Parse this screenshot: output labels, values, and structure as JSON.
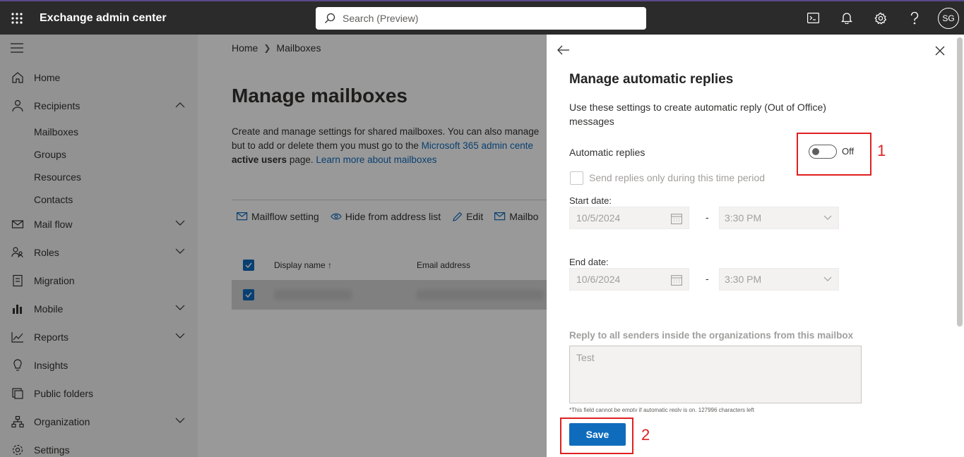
{
  "header": {
    "app_title": "Exchange admin center",
    "search_placeholder": "Search (Preview)",
    "avatar_initials": "SG"
  },
  "sidebar": {
    "items": [
      {
        "label": "Home",
        "icon": "home-icon"
      },
      {
        "label": "Recipients",
        "icon": "person-icon",
        "expanded": true
      },
      {
        "label": "Mail flow",
        "icon": "mail-icon"
      },
      {
        "label": "Roles",
        "icon": "roles-icon"
      },
      {
        "label": "Migration",
        "icon": "migration-icon"
      },
      {
        "label": "Mobile",
        "icon": "mobile-icon"
      },
      {
        "label": "Reports",
        "icon": "reports-icon"
      },
      {
        "label": "Insights",
        "icon": "lightbulb-icon"
      },
      {
        "label": "Public folders",
        "icon": "folder-icon"
      },
      {
        "label": "Organization",
        "icon": "organization-icon"
      },
      {
        "label": "Settings",
        "icon": "gear-icon"
      }
    ],
    "recipients_sub": [
      "Mailboxes",
      "Groups",
      "Resources",
      "Contacts"
    ]
  },
  "main": {
    "breadcrumb": [
      "Home",
      "Mailboxes"
    ],
    "title": "Manage mailboxes",
    "desc_line1": "Create and manage settings for shared mailboxes. You can also manage",
    "desc_line2_a": "but to add or delete them you must go to the ",
    "desc_line2_link": "Microsoft 365 admin cente",
    "desc_line3_bold": "active users",
    "desc_line3_a": " page. ",
    "desc_line3_link": "Learn more about mailboxes",
    "commands": [
      "Mailflow setting",
      "Hide from address list",
      "Edit",
      "Mailbo"
    ],
    "columns": {
      "display_name": "Display name",
      "email": "Email address"
    }
  },
  "panel": {
    "title": "Manage automatic replies",
    "description": "Use these settings to create automatic reply (Out of Office) messages",
    "automatic_replies_label": "Automatic replies",
    "toggle_state": "Off",
    "annotation_1": "1",
    "checkbox_label": "Send replies only during this time period",
    "start_date_label": "Start date:",
    "start_date": "10/5/2024",
    "start_time": "3:30 PM",
    "end_date_label": "End date:",
    "end_date": "10/6/2024",
    "end_time": "3:30 PM",
    "dash": "-",
    "reply_label": "Reply to all senders inside the organizations from this mailbox",
    "reply_text": "Test",
    "hint": "*This field cannot be empty if automatic reply is on. 127996 characters left",
    "save_label": "Save",
    "annotation_2": "2"
  },
  "colors": {
    "topbar": "#2b2b2b",
    "accent": "#0f6cbd",
    "annotation": "#e02020"
  }
}
